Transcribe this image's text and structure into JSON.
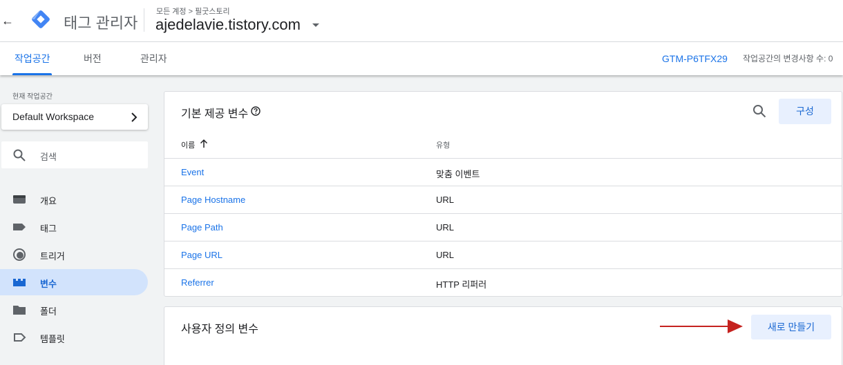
{
  "header": {
    "back_icon": "arrow-back-icon",
    "app_title": "태그 관리자",
    "breadcrumb": "모든 계정 > 필굿스토리",
    "container_name": "ajedelavie.tistory.com"
  },
  "tabs": [
    {
      "label": "작업공간",
      "active": true
    },
    {
      "label": "버전",
      "active": false
    },
    {
      "label": "관리자",
      "active": false
    }
  ],
  "container_id": "GTM-P6TFX29",
  "workspace_changes": "작업공간의 변경사항 수: 0",
  "sidebar": {
    "workspace_label": "현재 작업공간",
    "workspace_name": "Default Workspace",
    "search_placeholder": "검색",
    "items": [
      {
        "label": "개요",
        "icon": "overview-icon",
        "active": false
      },
      {
        "label": "태그",
        "icon": "tag-icon",
        "active": false
      },
      {
        "label": "트리거",
        "icon": "trigger-icon",
        "active": false
      },
      {
        "label": "변수",
        "icon": "variable-icon",
        "active": true
      },
      {
        "label": "폴더",
        "icon": "folder-icon",
        "active": false
      },
      {
        "label": "템플릿",
        "icon": "template-icon",
        "active": false
      }
    ]
  },
  "builtin_variables": {
    "title": "기본 제공 변수",
    "configure_label": "구성",
    "columns": {
      "name": "이름",
      "type": "유형"
    },
    "rows": [
      {
        "name": "Event",
        "type": "맞춤 이벤트"
      },
      {
        "name": "Page Hostname",
        "type": "URL"
      },
      {
        "name": "Page Path",
        "type": "URL"
      },
      {
        "name": "Page URL",
        "type": "URL"
      },
      {
        "name": "Referrer",
        "type": "HTTP 리퍼러"
      }
    ]
  },
  "user_variables": {
    "title": "사용자 정의 변수",
    "new_label": "새로 만들기"
  },
  "colors": {
    "accent": "#1a73e8",
    "active_nav_bg": "#d2e3fc",
    "annotation_arrow": "#c5221f"
  }
}
